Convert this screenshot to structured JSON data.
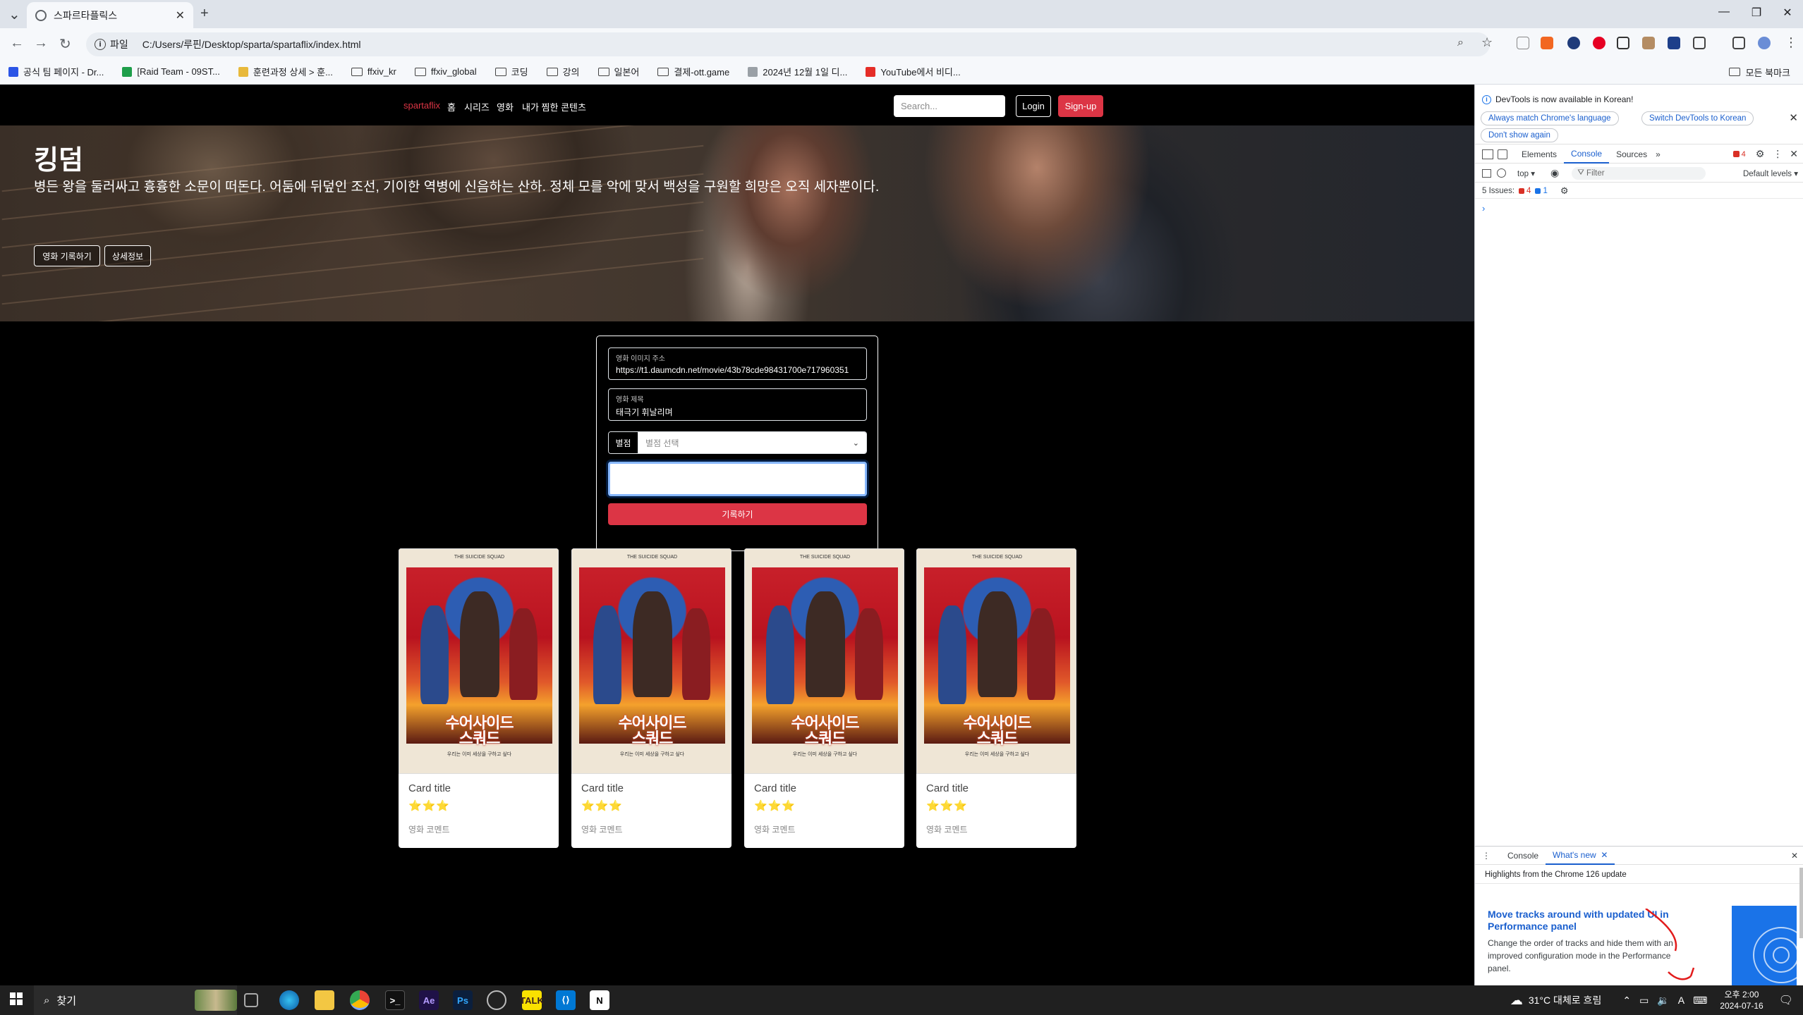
{
  "browser": {
    "tab_title": "스파르타플릭스",
    "new_tab_icon": "+",
    "omnibox_chip": "파일",
    "url": "C:/Users/루핀/Desktop/sparta/spartaflix/index.html",
    "bookmarks": [
      {
        "label": "공식 팀 페이지 - Dr...",
        "icon": "teams-icon",
        "color": "#2b55e6"
      },
      {
        "label": "[Raid Team - 09ST...",
        "icon": "sheets-icon",
        "color": "#1e9e4a"
      },
      {
        "label": "훈련과정 상세 > 훈...",
        "icon": "course-icon",
        "color": "#e8b93b"
      },
      {
        "label": "ffxiv_kr",
        "icon": "folder-icon"
      },
      {
        "label": "ffxiv_global",
        "icon": "folder-icon"
      },
      {
        "label": "코딩",
        "icon": "folder-icon"
      },
      {
        "label": "강의",
        "icon": "folder-icon"
      },
      {
        "label": "일본어",
        "icon": "folder-icon"
      },
      {
        "label": "결제-ott.game",
        "icon": "folder-icon"
      },
      {
        "label": "2024년 12월 1일 디...",
        "icon": "doc-icon",
        "color": "#9aa0a6"
      },
      {
        "label": "YouTube에서 비디...",
        "icon": "youtube-icon",
        "color": "#e52d27"
      }
    ],
    "all_bookmarks": "모든 북마크"
  },
  "site": {
    "brand": "spartaflix",
    "nav": [
      "홈",
      "시리즈",
      "영화",
      "내가 찜한 콘텐츠"
    ],
    "search_placeholder": "Search...",
    "login": "Login",
    "signup": "Sign-up",
    "hero": {
      "title": "킹덤",
      "description": "병든 왕을 둘러싸고 흉흉한 소문이 떠돈다. 어둠에 뒤덮인 조선, 기이한 역병에 신음하는 산하. 정체 모를 악에 맞서 백성을 구원할 희망은 오직 세자뿐이다.",
      "btn_record": "영화 기록하기",
      "btn_detail": "상세정보"
    },
    "form": {
      "image_label": "영화 이미지 주소",
      "image_value": "https://t1.daumcdn.net/movie/43b78cde98431700e717960351",
      "title_label": "영화 제목",
      "title_value": "태극기 휘날리며",
      "rating_label": "별점",
      "rating_value": "별점 선택",
      "submit": "기록하기"
    },
    "cards": [
      {
        "title": "Card title",
        "stars": "⭐⭐⭐",
        "comment": "영화 코멘트",
        "poster_title": "수어사이드\n스쿼드"
      },
      {
        "title": "Card title",
        "stars": "⭐⭐⭐",
        "comment": "영화 코멘트",
        "poster_title": "수어사이드\n스쿼드"
      },
      {
        "title": "Card title",
        "stars": "⭐⭐⭐",
        "comment": "영화 코멘트",
        "poster_title": "수어사이드\n스쿼드"
      },
      {
        "title": "Card title",
        "stars": "⭐⭐⭐",
        "comment": "영화 코멘트",
        "poster_title": "수어사이드\n스쿼드"
      }
    ]
  },
  "devtools": {
    "banner": "DevTools is now available in Korean!",
    "pill_match": "Always match Chrome's language",
    "pill_switch": "Switch DevTools to Korean",
    "pill_dont": "Don't show again",
    "tabs": [
      "Elements",
      "Console",
      "Sources"
    ],
    "active_tab": "Console",
    "error_count": "4",
    "context": "top",
    "filter_placeholder": "Filter",
    "levels": "Default levels",
    "issues_label": "5 Issues:",
    "issues_errors": "4",
    "issues_info": "1",
    "drawer_tabs": [
      "Console",
      "What's new"
    ],
    "drawer_heading": "Highlights from the Chrome 126 update",
    "whatsnew_title": "Move tracks around with updated UI in Performance panel",
    "whatsnew_body": "Change the order of tracks and hide them with an improved configuration mode in the Performance panel."
  },
  "taskbar": {
    "search": "찾기",
    "weather": "31°C 대체로 흐림",
    "ime": "A",
    "time": "오후 2:00",
    "date": "2024-07-16"
  }
}
